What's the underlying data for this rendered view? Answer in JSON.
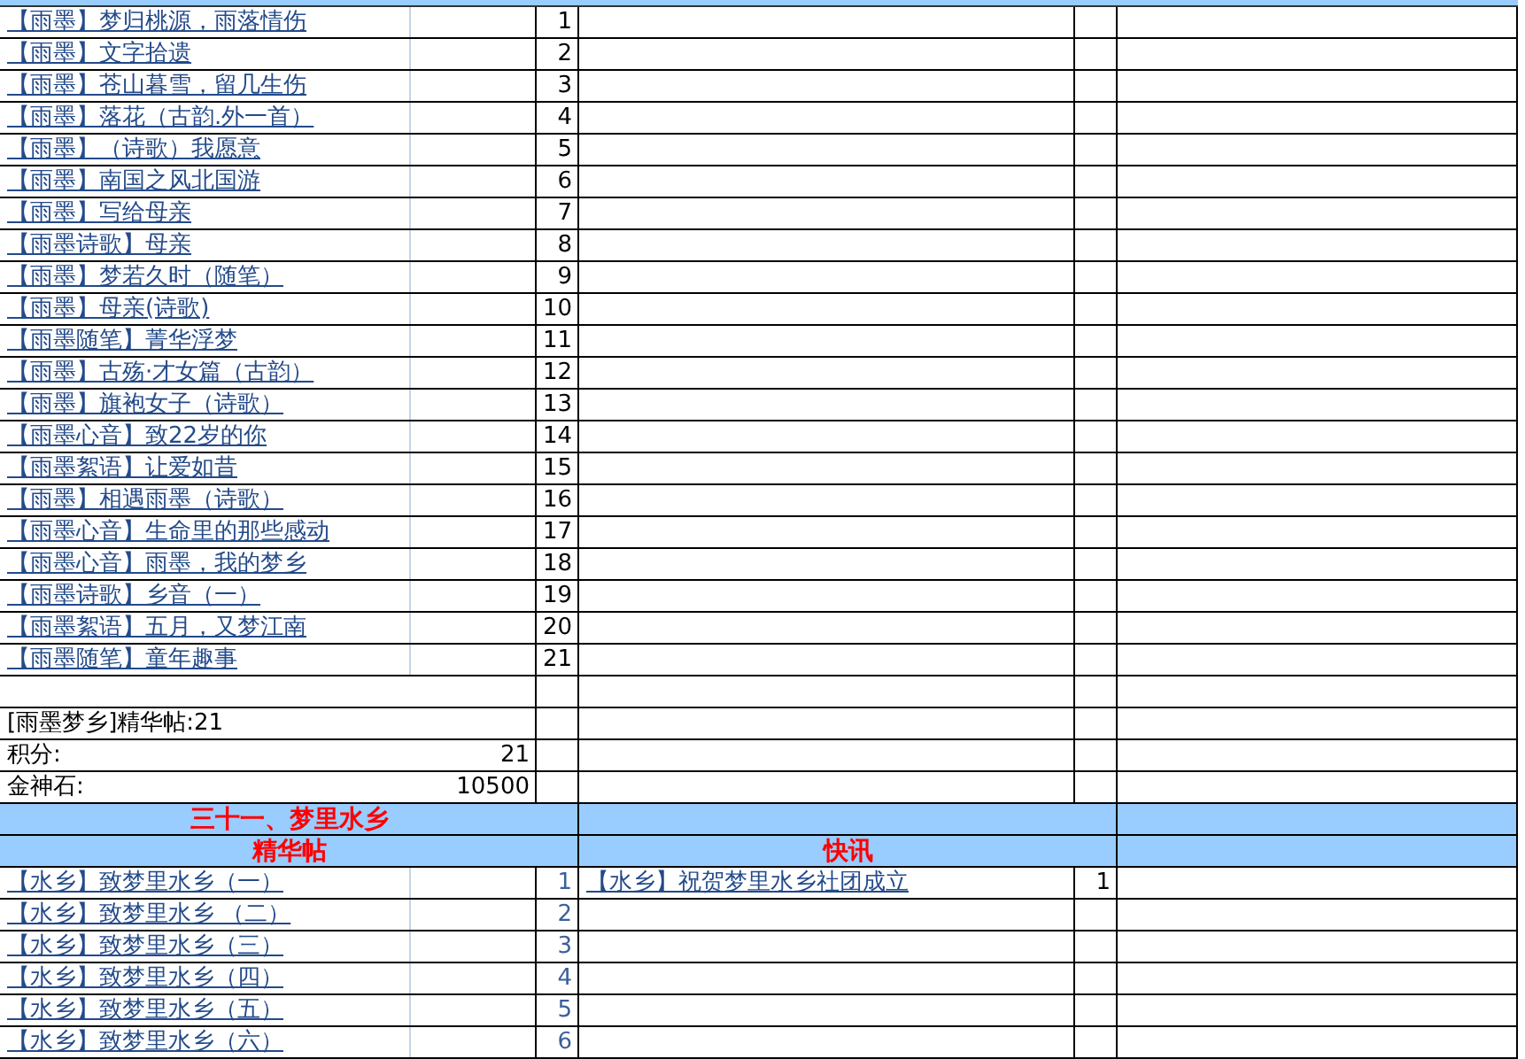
{
  "forum": {
    "posts": [
      {
        "title": "【雨墨】梦归桃源，雨落情伤",
        "number": "1"
      },
      {
        "title": "【雨墨】文字拾遗",
        "number": "2"
      },
      {
        "title": "【雨墨】苍山暮雪，留几生伤",
        "number": "3"
      },
      {
        "title": "【雨墨】落花（古韵.外一首）",
        "number": "4"
      },
      {
        "title": "【雨墨】（诗歌）我愿意",
        "number": "5"
      },
      {
        "title": "【雨墨】南国之风北国游",
        "number": "6"
      },
      {
        "title": "【雨墨】写给母亲",
        "number": "7"
      },
      {
        "title": "【雨墨诗歌】母亲",
        "number": "8"
      },
      {
        "title": "【雨墨】梦若久时（随笔）",
        "number": "9"
      },
      {
        "title": "【雨墨】母亲(诗歌)",
        "number": "10"
      },
      {
        "title": "【雨墨随笔】菁华浮梦",
        "number": "11"
      },
      {
        "title": "【雨墨】古殇·才女篇（古韵）",
        "number": "12"
      },
      {
        "title": "【雨墨】旗袍女子（诗歌）",
        "number": "13"
      },
      {
        "title": "【雨墨心音】致22岁的你",
        "number": "14"
      },
      {
        "title": "【雨墨絮语】让爱如昔",
        "number": "15"
      },
      {
        "title": "【雨墨】相遇雨墨（诗歌）",
        "number": "16"
      },
      {
        "title": "【雨墨心音】生命里的那些感动",
        "number": "17"
      },
      {
        "title": "【雨墨心音】雨墨，我的梦乡",
        "number": "18"
      },
      {
        "title": "【雨墨诗歌】乡音（一）",
        "number": "19"
      },
      {
        "title": "【雨墨絮语】五月，又梦江南",
        "number": "20"
      },
      {
        "title": "【雨墨随笔】童年趣事",
        "number": "21"
      }
    ],
    "summary": "[雨墨梦乡]精华帖:21",
    "points": {
      "label": "积分:",
      "value": "21"
    },
    "gold": {
      "label": "金神石:",
      "value": "10500"
    }
  },
  "section": {
    "title": "三十一、梦里水乡",
    "columns": [
      "精华帖",
      "快讯"
    ],
    "rows": [
      {
        "post": {
          "title": "【水乡】致梦里水乡（一）",
          "number": "1"
        },
        "news": {
          "title": "【水乡】祝贺梦里水乡社团成立",
          "number": "1"
        }
      },
      {
        "post": {
          "title": "【水乡】致梦里水乡 （二）",
          "number": "2"
        }
      },
      {
        "post": {
          "title": "【水乡】致梦里水乡（三）",
          "number": "3"
        }
      },
      {
        "post": {
          "title": "【水乡】致梦里水乡（四）",
          "number": "4"
        }
      },
      {
        "post": {
          "title": "【水乡】致梦里水乡（五）",
          "number": "5"
        }
      },
      {
        "post": {
          "title": "【水乡】致梦里水乡（六）",
          "number": "6"
        }
      }
    ]
  }
}
